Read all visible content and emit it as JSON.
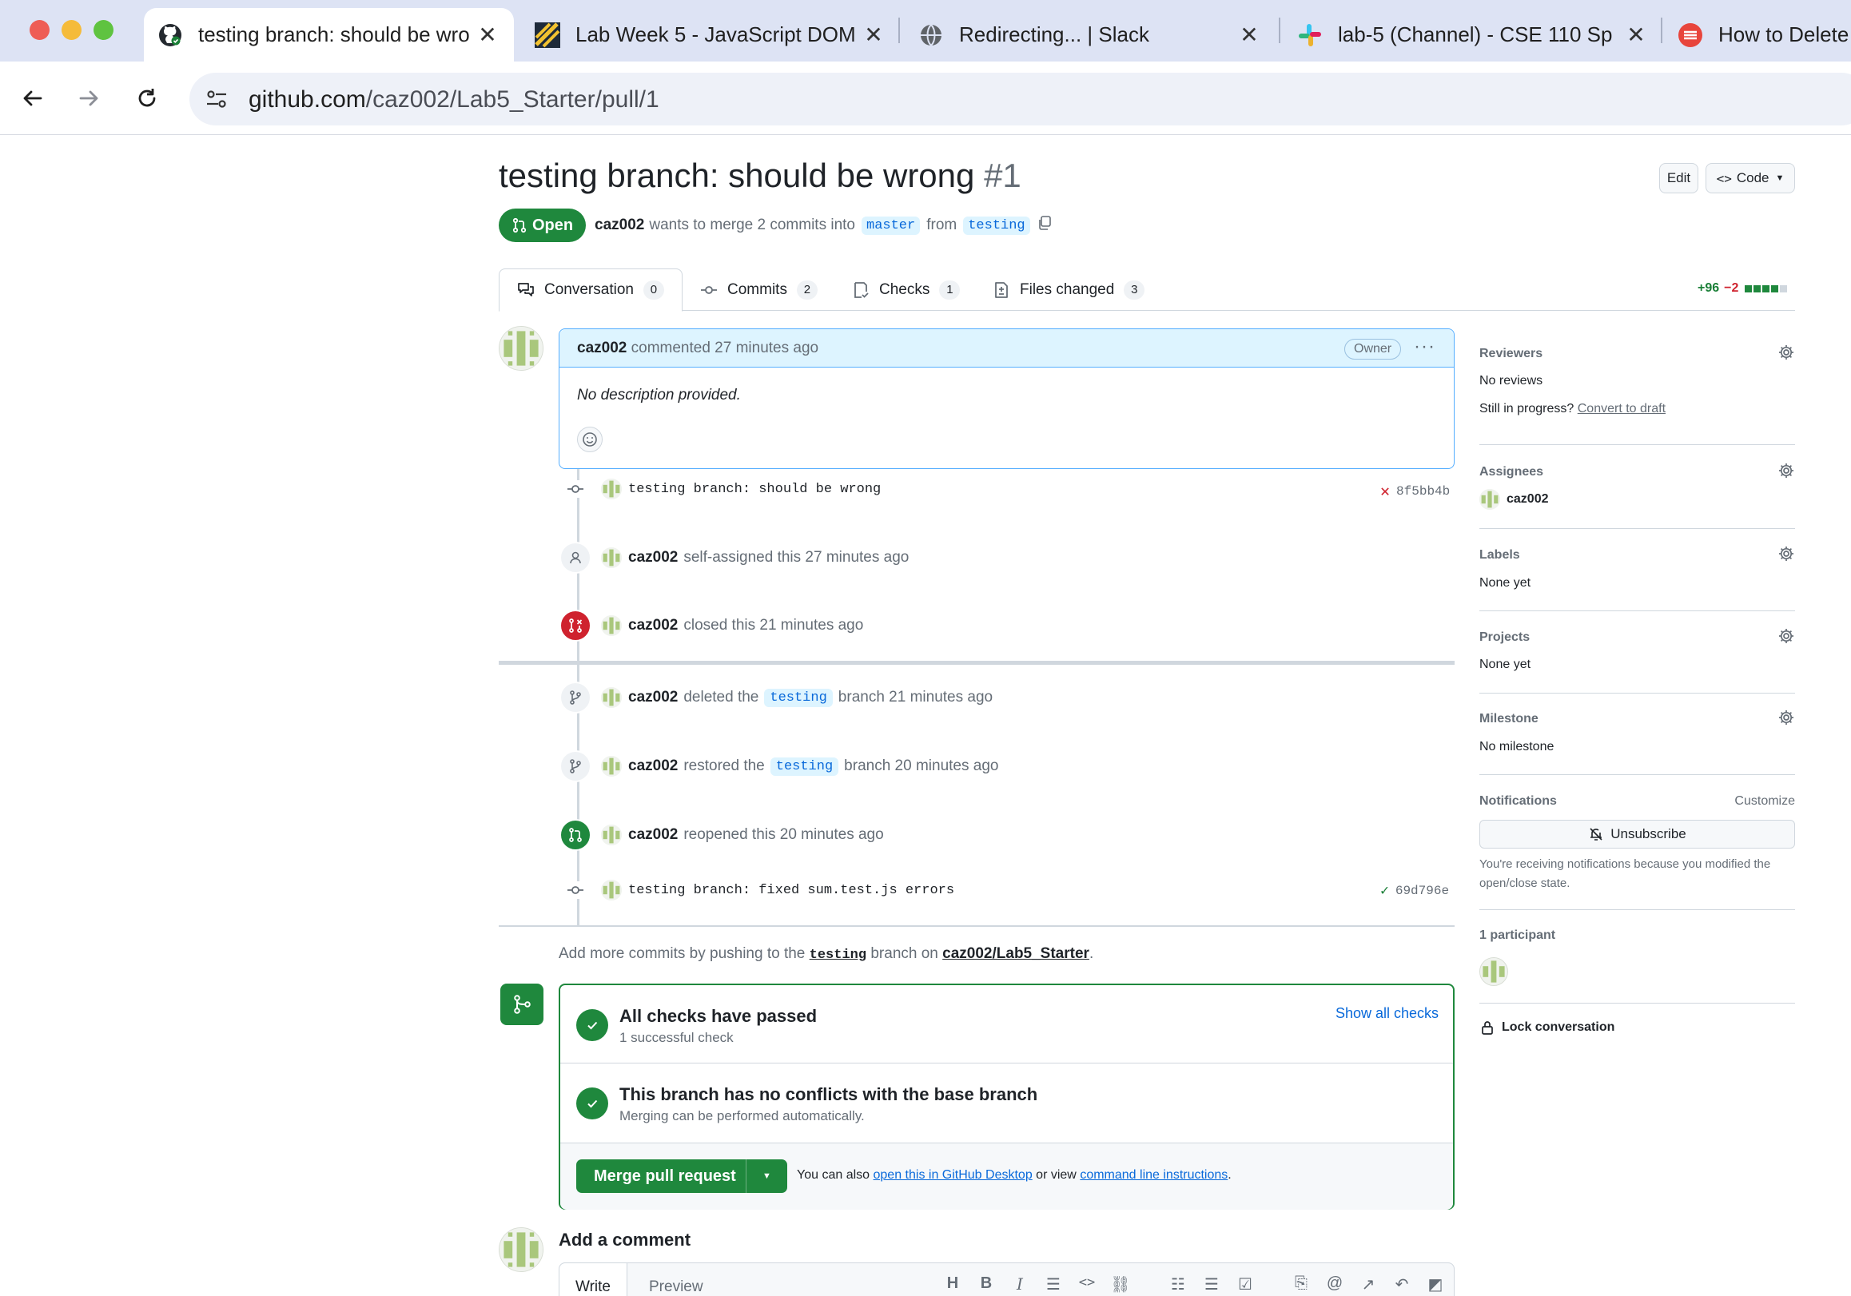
{
  "browser": {
    "tabs": [
      {
        "title": "testing branch: should be wro",
        "favicon": "github-icon",
        "active": true
      },
      {
        "title": "Lab Week 5 - JavaScript DOM",
        "favicon": "canvas-icon",
        "active": false
      },
      {
        "title": "Redirecting... | Slack",
        "favicon": "globe-icon",
        "active": false
      },
      {
        "title": "lab-5 (Channel) - CSE 110 Sp",
        "favicon": "slack-icon",
        "active": false
      },
      {
        "title": "How to Delete",
        "favicon": "red-logo-icon",
        "active": false
      }
    ],
    "url_host": "github.com",
    "url_path": "/caz002/Lab5_Starter/pull/1"
  },
  "pr": {
    "title": "testing branch: should be wrong",
    "number": "#1",
    "edit_label": "Edit",
    "code_label": "Code",
    "state": "Open",
    "author": "caz002",
    "meta_text_1": "wants to merge 2 commits into",
    "base_branch": "master",
    "meta_text_2": "from",
    "head_branch": "testing"
  },
  "tabs": [
    {
      "label": "Conversation",
      "count": "0"
    },
    {
      "label": "Commits",
      "count": "2"
    },
    {
      "label": "Checks",
      "count": "1"
    },
    {
      "label": "Files changed",
      "count": "3"
    }
  ],
  "diffstat": {
    "additions": "+96",
    "deletions": "−2"
  },
  "comment": {
    "author": "caz002",
    "action": "commented 27 minutes ago",
    "role": "Owner",
    "body": "No description provided."
  },
  "timeline": {
    "commit1": {
      "message": "testing branch: should be wrong",
      "sha": "8f5bb4b",
      "status": "failed"
    },
    "self_assigned": {
      "actor": "caz002",
      "text": "self-assigned this 27 minutes ago"
    },
    "closed": {
      "actor": "caz002",
      "text": "closed this 21 minutes ago"
    },
    "deleted": {
      "actor": "caz002",
      "pre": "deleted the",
      "branch": "testing",
      "post": "branch 21 minutes ago"
    },
    "restored": {
      "actor": "caz002",
      "pre": "restored the",
      "branch": "testing",
      "post": "branch 20 minutes ago"
    },
    "reopened": {
      "actor": "caz002",
      "text": "reopened this 20 minutes ago"
    },
    "commit2": {
      "message": "testing branch: fixed sum.test.js errors",
      "sha": "69d796e",
      "status": "passed"
    }
  },
  "push_hint": {
    "pre": "Add more commits by pushing to the",
    "branch": "testing",
    "mid": "branch on",
    "repo": "caz002/Lab5_Starter",
    "post": "."
  },
  "merge": {
    "checks_title": "All checks have passed",
    "checks_sub": "1 successful check",
    "show_checks": "Show all checks",
    "conflicts_title": "This branch has no conflicts with the base branch",
    "conflicts_sub": "Merging can be performed automatically.",
    "merge_button": "Merge pull request",
    "foot_pre": "You can also",
    "foot_link1": "open this in GitHub Desktop",
    "foot_mid": "or view",
    "foot_link2": "command line instructions",
    "foot_post": "."
  },
  "add_comment": {
    "title": "Add a comment",
    "write_tab": "Write",
    "preview_tab": "Preview"
  },
  "sidebar": {
    "reviewers": {
      "label": "Reviewers",
      "value": "No reviews",
      "progress_text": "Still in progress?",
      "progress_link": "Convert to draft"
    },
    "assignees": {
      "label": "Assignees",
      "value": "caz002"
    },
    "labels": {
      "label": "Labels",
      "value": "None yet"
    },
    "projects": {
      "label": "Projects",
      "value": "None yet"
    },
    "milestone": {
      "label": "Milestone",
      "value": "No milestone"
    },
    "notifications": {
      "label": "Notifications",
      "customize": "Customize",
      "button": "Unsubscribe",
      "note": "You're receiving notifications because you modified the open/close state."
    },
    "participants": {
      "label": "1 participant"
    },
    "lock": "Lock conversation"
  },
  "colors": {
    "accent_green": "#1f883d",
    "danger_red": "#cf222e",
    "link_blue": "#0969da",
    "tabstrip": "#dde3f4"
  }
}
